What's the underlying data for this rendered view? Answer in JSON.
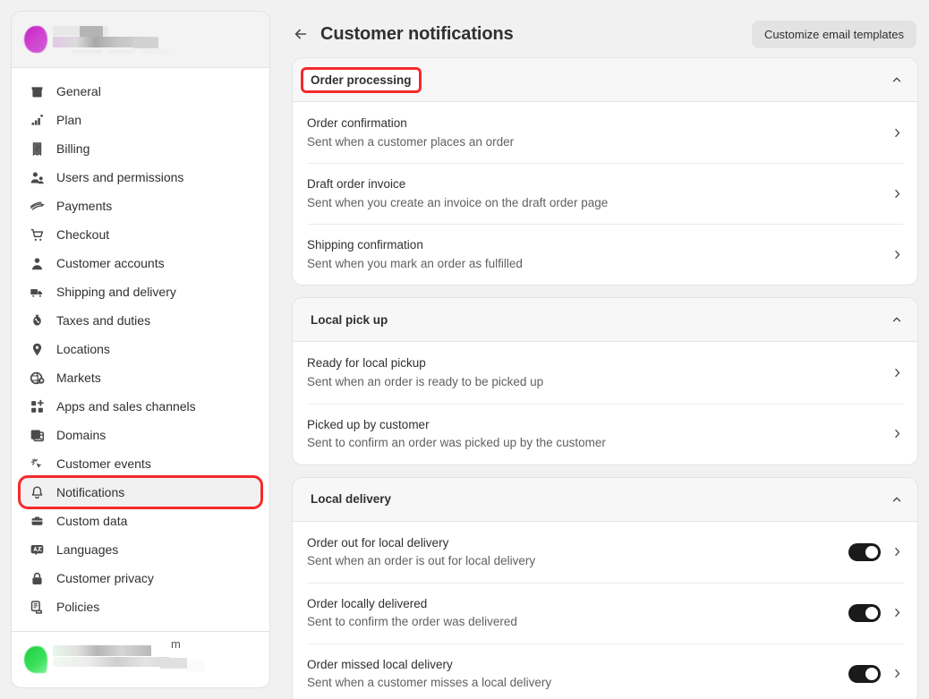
{
  "sidebar": {
    "store_name_blurred": "",
    "items": [
      {
        "label": "General",
        "icon": "store-icon"
      },
      {
        "label": "Plan",
        "icon": "chart-growth-icon"
      },
      {
        "label": "Billing",
        "icon": "receipt-dollar-icon"
      },
      {
        "label": "Users and permissions",
        "icon": "users-icon"
      },
      {
        "label": "Payments",
        "icon": "payment-icon"
      },
      {
        "label": "Checkout",
        "icon": "cart-icon"
      },
      {
        "label": "Customer accounts",
        "icon": "person-icon"
      },
      {
        "label": "Shipping and delivery",
        "icon": "delivery-truck-icon"
      },
      {
        "label": "Taxes and duties",
        "icon": "tax-icon"
      },
      {
        "label": "Locations",
        "icon": "location-pin-icon"
      },
      {
        "label": "Markets",
        "icon": "globe-dollar-icon"
      },
      {
        "label": "Apps and sales channels",
        "icon": "apps-grid-icon"
      },
      {
        "label": "Domains",
        "icon": "domains-window-icon"
      },
      {
        "label": "Customer events",
        "icon": "cursor-sparkle-icon"
      },
      {
        "label": "Notifications",
        "icon": "bell-icon"
      },
      {
        "label": "Custom data",
        "icon": "database-icon"
      },
      {
        "label": "Languages",
        "icon": "translate-icon"
      },
      {
        "label": "Customer privacy",
        "icon": "lock-icon"
      },
      {
        "label": "Policies",
        "icon": "policies-icon"
      }
    ],
    "selected_index": 14,
    "highlighted_index": 14,
    "footer": {
      "trailing_text": "m"
    }
  },
  "header": {
    "back_icon": "arrow-left-icon",
    "title": "Customer notifications",
    "customize_button": "Customize email templates"
  },
  "highlight_color": "#f52a2a",
  "sections": [
    {
      "title": "Order processing",
      "highlighted": true,
      "collapse_icon": "chevron-up-icon",
      "rows": [
        {
          "title": "Order confirmation",
          "subtitle": "Sent when a customer places an order",
          "toggle": null
        },
        {
          "title": "Draft order invoice",
          "subtitle": "Sent when you create an invoice on the draft order page",
          "toggle": null
        },
        {
          "title": "Shipping confirmation",
          "subtitle": "Sent when you mark an order as fulfilled",
          "toggle": null
        }
      ]
    },
    {
      "title": "Local pick up",
      "highlighted": false,
      "collapse_icon": "chevron-up-icon",
      "rows": [
        {
          "title": "Ready for local pickup",
          "subtitle": "Sent when an order is ready to be picked up",
          "toggle": null
        },
        {
          "title": "Picked up by customer",
          "subtitle": "Sent to confirm an order was picked up by the customer",
          "toggle": null
        }
      ]
    },
    {
      "title": "Local delivery",
      "highlighted": false,
      "collapse_icon": "chevron-up-icon",
      "rows": [
        {
          "title": "Order out for local delivery",
          "subtitle": "Sent when an order is out for local delivery",
          "toggle": "on"
        },
        {
          "title": "Order locally delivered",
          "subtitle": "Sent to confirm the order was delivered",
          "toggle": "on"
        },
        {
          "title": "Order missed local delivery",
          "subtitle": "Sent when a customer misses a local delivery",
          "toggle": "on"
        }
      ]
    }
  ]
}
